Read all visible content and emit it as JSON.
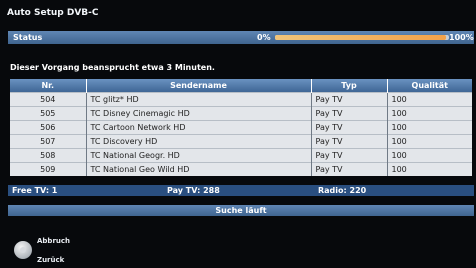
{
  "title": "Auto Setup DVB-C",
  "status": {
    "label": "Status",
    "progress_start": "0%",
    "progress_end": "100%",
    "progress_fraction": 0.98
  },
  "message": "Dieser Vorgang beansprucht etwa 3 Minuten.",
  "table": {
    "headers": [
      "Nr.",
      "Sendername",
      "Typ",
      "Qualität"
    ],
    "rows": [
      [
        "504",
        "TC glitz* HD",
        "Pay TV",
        "100"
      ],
      [
        "505",
        "TC Disney Cinemagic HD",
        "Pay TV",
        "100"
      ],
      [
        "506",
        "TC Cartoon Network HD",
        "Pay TV",
        "100"
      ],
      [
        "507",
        "TC Discovery HD",
        "Pay TV",
        "100"
      ],
      [
        "508",
        "TC National Geogr. HD",
        "Pay TV",
        "100"
      ],
      [
        "509",
        "TC National Geo Wild HD",
        "Pay TV",
        "100"
      ]
    ]
  },
  "counts": {
    "free_tv": "Free TV: 1",
    "pay_tv": "Pay TV: 288",
    "radio": "Radio: 220"
  },
  "searching": "Suche läuft",
  "hints": {
    "cancel": "Abbruch",
    "back": "Zurück",
    "remote_icon": "remote-dpad-icon"
  }
}
